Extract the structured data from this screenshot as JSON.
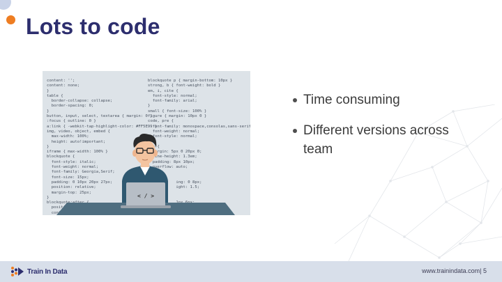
{
  "slide": {
    "title": "Lots to code",
    "bullets": [
      {
        "text": "Time consuming"
      },
      {
        "text": "Different versions across team"
      }
    ]
  },
  "illustration": {
    "laptop_glyph": "< / >",
    "code_left": "content: '';\ncontent: none;\n}\ntable {\n  border-collapse: collapse;\n  border-spacing: 0;\n}\nbutton, input, select, textarea { margin: 0 }\n:focus { outline: 0 }\na:link { -webkit-tap-highlight-color: #FF5E99 }\nimg, video, object, embed {\n  max-width: 100%;\n  height: auto!important;\n}\niframe { max-width: 100% }\nblockquote {\n  font-style: italic;\n  font-weight: normal;\n  font-family: Georgia,Serif;\n  font-size: 15px;\n  padding: 0 10px 20px 27px;\n  position: relative;\n  margin-top: 25px;\n}\nblockquote:after {\n  position: absolute;\n  content: '\"';",
    "code_right": "blockquote p { margin-bottom: 10px }\nstrong, b { font-weight: bold }\nem, i, cite {\n  font-style: normal;\n  font-family: arial;\n}\nsmall { font-size: 100% }\nfigure { margin: 10px 0 }\ncode, pre {\n  font-family: monospace,consolas,sans-serif;\n  font-weight: normal;\n  font-style: normal;\n}\npre {\n  margin: 5px 0 20px 0;\n  line-height: 1.3em;\n  padding: 8px 10px;\n  overflow: auto;\n}\n\n            ing: 0 8px;\n            ight: 1.5;\n\n\n            1px 6px;\n            0 2px;\n            lack;"
  },
  "footer": {
    "logo_text": "Train In Data",
    "url": "www.trainindata.com| 5"
  },
  "colors": {
    "title": "#2d2e6e",
    "accent_orange": "#ee7d22",
    "footer_bg": "#d8dfea"
  }
}
